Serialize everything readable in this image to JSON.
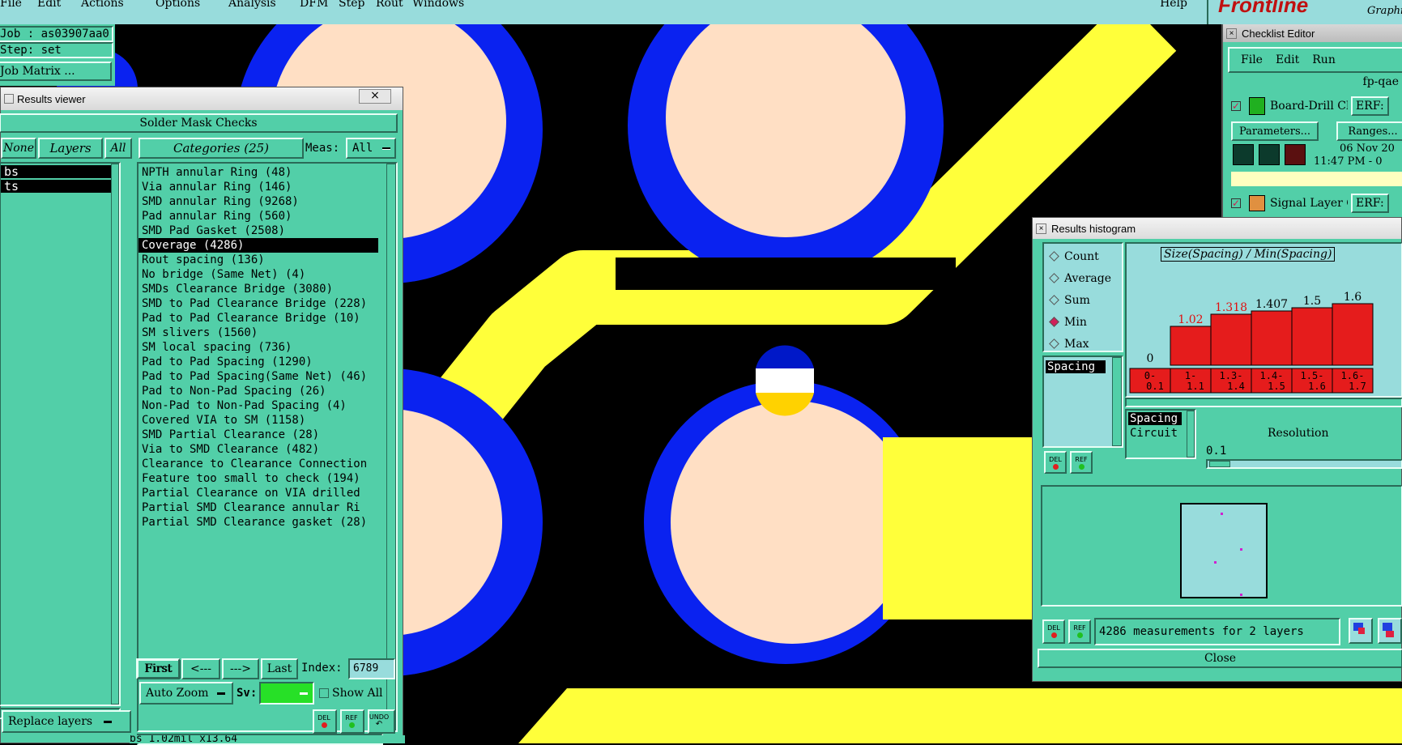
{
  "menubar": {
    "items": [
      "File",
      "Edit",
      "Actions",
      "Options",
      "Analysis",
      "DFM",
      "Step",
      "Rout",
      "Windows"
    ],
    "help": "Help",
    "brand": "Frontline",
    "brand_sub": "Graphi"
  },
  "job_panel": {
    "job": "Job : as03907aa0",
    "step": "Step: set",
    "matrix_btn": "Job Matrix ..."
  },
  "results_viewer": {
    "title": "Results viewer",
    "header": "Solder Mask Checks",
    "none_btn": "None",
    "layers_btn": "Layers",
    "all_btn": "All",
    "categories_btn": "Categories (25)",
    "meas_label": "Meas:",
    "meas_value": "All",
    "layers": [
      "bs",
      "ts"
    ],
    "categories": [
      "NPTH annular Ring (48)",
      "Via annular Ring (146)",
      "SMD annular Ring (9268)",
      "Pad annular Ring (560)",
      "SMD Pad Gasket (2508)",
      "Coverage (4286)",
      "Rout spacing (136)",
      "No bridge (Same Net) (4)",
      "SMDs Clearance Bridge (3080)",
      "SMD to Pad Clearance Bridge (228)",
      "Pad to Pad Clearance Bridge (10)",
      "SM slivers (1560)",
      "SM local spacing (736)",
      "Pad to Pad Spacing (1290)",
      "Pad to Pad Spacing(Same Net) (46)",
      "Pad to Non-Pad Spacing (26)",
      "Non-Pad to Non-Pad Spacing (4)",
      "Covered VIA to SM (1158)",
      "SMD Partial Clearance (28)",
      "Via to SMD Clearance (482)",
      "Clearance to Clearance Connection",
      "Feature too small to check (194)",
      "Partial Clearance on VIA drilled",
      "Partial SMD Clearance annular Ri",
      "Partial SMD Clearance gasket (28)"
    ],
    "selected_index": 5,
    "first_btn": "First",
    "prev_btn": "<---",
    "next_btn": "--->",
    "last_btn": "Last",
    "index_label": "Index:",
    "index_value": "6789",
    "autozoom": "Auto Zoom",
    "sv_label": "Sv:",
    "showall_label": "Show All",
    "replace_layers": "Replace layers",
    "del": "DEL",
    "ref": "REF",
    "undo": "UNDO",
    "status": "bs 1.02mil  x13.64"
  },
  "checklist_editor": {
    "title": "Checklist Editor",
    "menu": [
      "File",
      "Edit",
      "Run"
    ],
    "name": "fp-qae",
    "item1": "Board-Drill Che",
    "erf": "ERF:",
    "params_btn": "Parameters...",
    "ranges_btn": "Ranges...",
    "date": "06 Nov 20",
    "time": "11:47 PM - 0",
    "item2": "Signal Layer Ch"
  },
  "histogram": {
    "title": "Results histogram",
    "options": [
      "Count",
      "Average",
      "Sum",
      "Min",
      "Max"
    ],
    "selected_option": "Min",
    "list_item": "Spacing",
    "chart_title": "Size(Spacing) / Min(Spacing)",
    "measurements": "4286 measurements for 2 layers",
    "close_btn": "Close",
    "spacing_list": [
      "Spacing",
      "Circuit"
    ],
    "resolution_label": "Resolution",
    "resolution_value": "0.1",
    "del": "DEL",
    "ref": "REF"
  },
  "chart_data": {
    "type": "bar",
    "title": "Size(Spacing) / Min(Spacing)",
    "categories": [
      "0-0.1",
      "1-1.1",
      "1.3-1.4",
      "1.4-1.5",
      "1.5-1.6",
      "1.6-1.7"
    ],
    "values": [
      0,
      1.02,
      1.318,
      1.407,
      1.5,
      1.6
    ],
    "value_labels": [
      "0",
      "1.02",
      "1.318",
      "1.407",
      "1.5",
      "1.6"
    ],
    "ylim": [
      0,
      1.6
    ]
  },
  "colors": {
    "panel": "#52cfa8",
    "menubar": "#98dcdc",
    "pad_fill": "#ffdfc4",
    "pad_ring": "#0a22f0",
    "trace": "#ffff3a",
    "bar": "#e51c1c"
  }
}
